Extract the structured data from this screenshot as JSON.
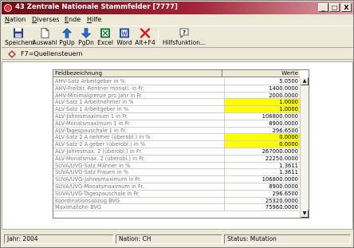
{
  "window": {
    "title": "43 Zentrale Nationale Stammfelder [7777]",
    "controls": {
      "minimize": "_",
      "maximize": "□",
      "close": "X"
    }
  },
  "menu": [
    "Nation",
    "Diverses",
    "Ende",
    "Hilfe"
  ],
  "toolbar": [
    {
      "label": "Speichern",
      "icon": "save-icon"
    },
    {
      "label": "Auswahl",
      "icon": "document-icon"
    },
    {
      "label": "PgUp",
      "icon": "arrow-up-icon"
    },
    {
      "label": "PgDn",
      "icon": "arrow-down-icon"
    },
    {
      "label": "Excel",
      "icon": "excel-icon"
    },
    {
      "label": "Word",
      "icon": "word-icon"
    },
    {
      "label": "Alt+F4",
      "icon": "close-x-icon"
    },
    {
      "label": "Hilfsfunktion...",
      "icon": "help-icon"
    }
  ],
  "info": {
    "text": "F7=Quellensteuern",
    "icon": "diamond-icon"
  },
  "table": {
    "columns": [
      "Feldbezeichnung",
      "Werte"
    ],
    "rows": [
      {
        "name": "AHV-Satz Arbeitgeber in %",
        "value": "5.0500",
        "highlight": false
      },
      {
        "name": "AHV-Freibtr. Rentner monatl. in Fr.",
        "value": "1400.0000",
        "highlight": false
      },
      {
        "name": "AHV-Minimalgrenze pro Jahr in Fr.",
        "value": "2000.0000",
        "highlight": false
      },
      {
        "name": "ALV-Satz 1 Arbeitnehmer in %",
        "value": "1.0000",
        "highlight": true
      },
      {
        "name": "ALV-Satz 1 Arbeitgeber in %",
        "value": "1.0000",
        "highlight": true
      },
      {
        "name": "ALV-Jahresmaximum 1 in Fr.",
        "value": "106800.0000",
        "highlight": false
      },
      {
        "name": "ALV-Monatsmaximum 1 in Fr.",
        "value": "8900.0000",
        "highlight": false
      },
      {
        "name": "ALV-Tagespauschale 1 in Fr.",
        "value": "296.6500",
        "highlight": false
      },
      {
        "name": "ALV-Satz 2 A.nehmer (überobl.) in %",
        "value": "0.0000",
        "highlight": true
      },
      {
        "name": "ALV-Satz 2 A.geber (überobl.) in %",
        "value": "0.0000",
        "highlight": true
      },
      {
        "name": "ALV-Jahresmax. 2 (überobl.) in Fr.",
        "value": "267000.0000",
        "highlight": false
      },
      {
        "name": "ALV-Monatsmax. 2 (überobl.) in Fr.",
        "value": "22250.0000",
        "highlight": false
      },
      {
        "name": "SUVA/UVG-Satz Männer in %",
        "value": "1.3611",
        "highlight": false
      },
      {
        "name": "SUVA/UVG-Satz Frauen in %",
        "value": "1.3611",
        "highlight": false
      },
      {
        "name": "SUVA/UVG-Jahresmaximum in Fr.",
        "value": "106800.0000",
        "highlight": false
      },
      {
        "name": "SUVA/UVG-Monatsmaximum in Fr.",
        "value": "8900.0000",
        "highlight": false
      },
      {
        "name": "SUVA/UVG-Tagespauschale in Fr.",
        "value": "296.6500",
        "highlight": false
      },
      {
        "name": "Koordinationsabzug BVG",
        "value": "25320.0000",
        "highlight": false
      },
      {
        "name": "Maximallohn BVG",
        "value": "75960.0000",
        "highlight": false
      }
    ]
  },
  "status": {
    "year": "Jahr: 2004",
    "nation": "Nation: CH",
    "mode": "Status: Mutation"
  },
  "colors": {
    "title_start": "#6b0f1a",
    "highlight": "#ffff00",
    "label_gray": "#7a7a7a"
  }
}
